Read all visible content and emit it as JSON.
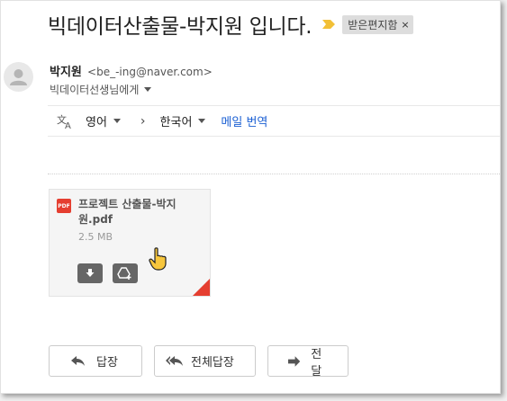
{
  "email": {
    "subject": "빅데이터산출물-박지원 입니다.",
    "label": "받은편지함",
    "label_close": "×",
    "sender_name": "박지원",
    "sender_email": "<be_-ing@naver.com>",
    "recipient": "빅데이터선생님에게"
  },
  "translate": {
    "source_lang": "영어",
    "arrow": "›",
    "target_lang": "한국어",
    "message_translate": "메일 번역"
  },
  "attachment": {
    "type_label": "PDF",
    "filename": "프로젝트 산출물-박지원.pdf",
    "size": "2.5 MB"
  },
  "actions": {
    "reply": "답장",
    "reply_all": "전체답장",
    "forward": "전달"
  },
  "colors": {
    "pdf_red": "#e53e30",
    "link_blue": "#1a5fd3",
    "importance_yellow": "#f2c037"
  },
  "icons": [
    "importance-marker-icon",
    "avatar-person-icon",
    "translate-icon",
    "pdf-icon",
    "download-icon",
    "save-to-drive-icon",
    "hand-cursor-icon",
    "reply-icon",
    "reply-all-icon",
    "forward-icon"
  ]
}
